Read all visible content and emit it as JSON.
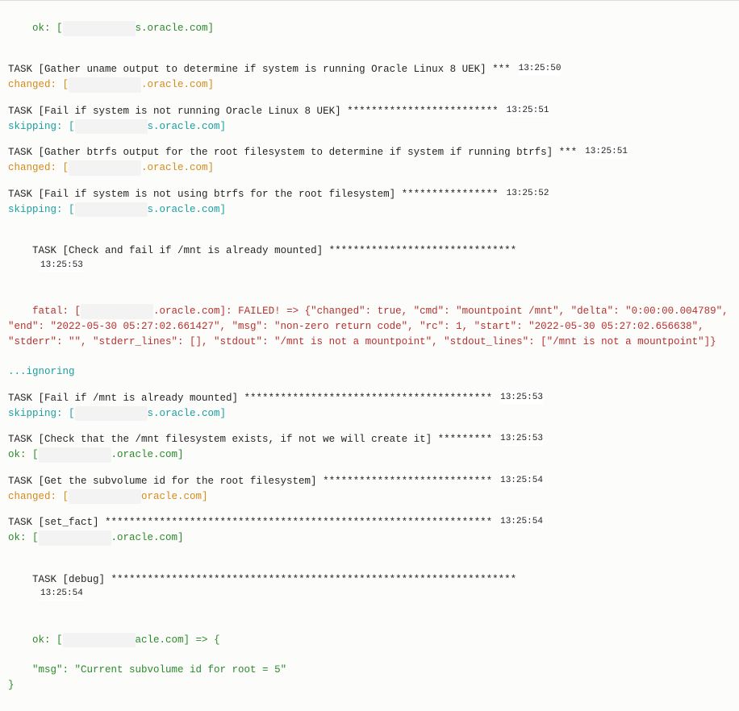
{
  "hostSuffix": "s.oracle.com",
  "hostSuffixAlt": ".oracle.com",
  "hostSuffixAlt2": "acle.com",
  "redact": "            ",
  "tasks": [
    {
      "title": "TASK [Gather uname output to determine if system is running Oracle Linux 8 UEK] ***",
      "ts": "13:25:50",
      "status": "changed",
      "statusPrefix": "changed: [",
      "suffix": ".oracle.com]"
    },
    {
      "title": "TASK [Fail if system is not running Oracle Linux 8 UEK] *************************",
      "ts": "13:25:51",
      "status": "skip",
      "statusPrefix": "skipping: [",
      "suffix": "s.oracle.com]"
    },
    {
      "title": "TASK [Gather btrfs output for the root filesystem to determine if system if running btrfs] ***",
      "ts": "13:25:51",
      "status": "changed",
      "statusPrefix": "changed: [",
      "suffix": ".oracle.com]"
    },
    {
      "title": "TASK [Fail if system is not using btrfs for the root filesystem] ****************",
      "ts": "13:25:52",
      "status": "skip",
      "statusPrefix": "skipping: [",
      "suffix": "s.oracle.com]"
    }
  ],
  "task0": {
    "statusPrefix": "ok: [",
    "suffix": "s.oracle.com]"
  },
  "fatalTask": {
    "title": "TASK [Check and fail if /mnt is already mounted] *******************************",
    "ts": "13:25:53",
    "prefix": "fatal: [",
    "suffix": ".oracle.com]: FAILED! => {\"changed\": true, \"cmd\": \"mountpoint /mnt\", \"delta\": \"0:00:00.004789\", \"end\": \"2022-05-30 05:27:02.661427\", \"msg\": \"non-zero return code\", \"rc\": 1, \"start\": \"2022-05-30 05:27:02.656638\", \"stderr\": \"\", \"stderr_lines\": [], \"stdout\": \"/mnt is not a mountpoint\", \"stdout_lines\": [\"/mnt is not a mountpoint\"]}",
    "ignore": "...ignoring"
  },
  "tasks2": [
    {
      "title": "TASK [Fail if /mnt is already mounted] *****************************************",
      "ts": "13:25:53",
      "status": "skip",
      "statusPrefix": "skipping: [",
      "suffix": "s.oracle.com]"
    },
    {
      "title": "TASK [Check that the /mnt filesystem exists, if not we will create it] *********",
      "ts": "13:25:53",
      "status": "ok",
      "statusPrefix": "ok: [",
      "suffix": ".oracle.com]"
    },
    {
      "title": "TASK [Get the subvolume id for the root filesystem] ****************************",
      "ts": "13:25:54",
      "status": "changed",
      "statusPrefix": "changed: [",
      "suffix": "oracle.com]"
    },
    {
      "title": "TASK [set_fact] ****************************************************************",
      "ts": "13:25:54",
      "status": "ok",
      "statusPrefix": "ok: [",
      "suffix": ".oracle.com]"
    }
  ],
  "debugTask": {
    "title": "TASK [debug] *******************************************************************",
    "ts": "13:25:54",
    "prefix": "ok: [",
    "suffix": "acle.com] => {",
    "msgLine": "    \"msg\": \"Current subvolume id for root = 5\"",
    "close": "}"
  }
}
